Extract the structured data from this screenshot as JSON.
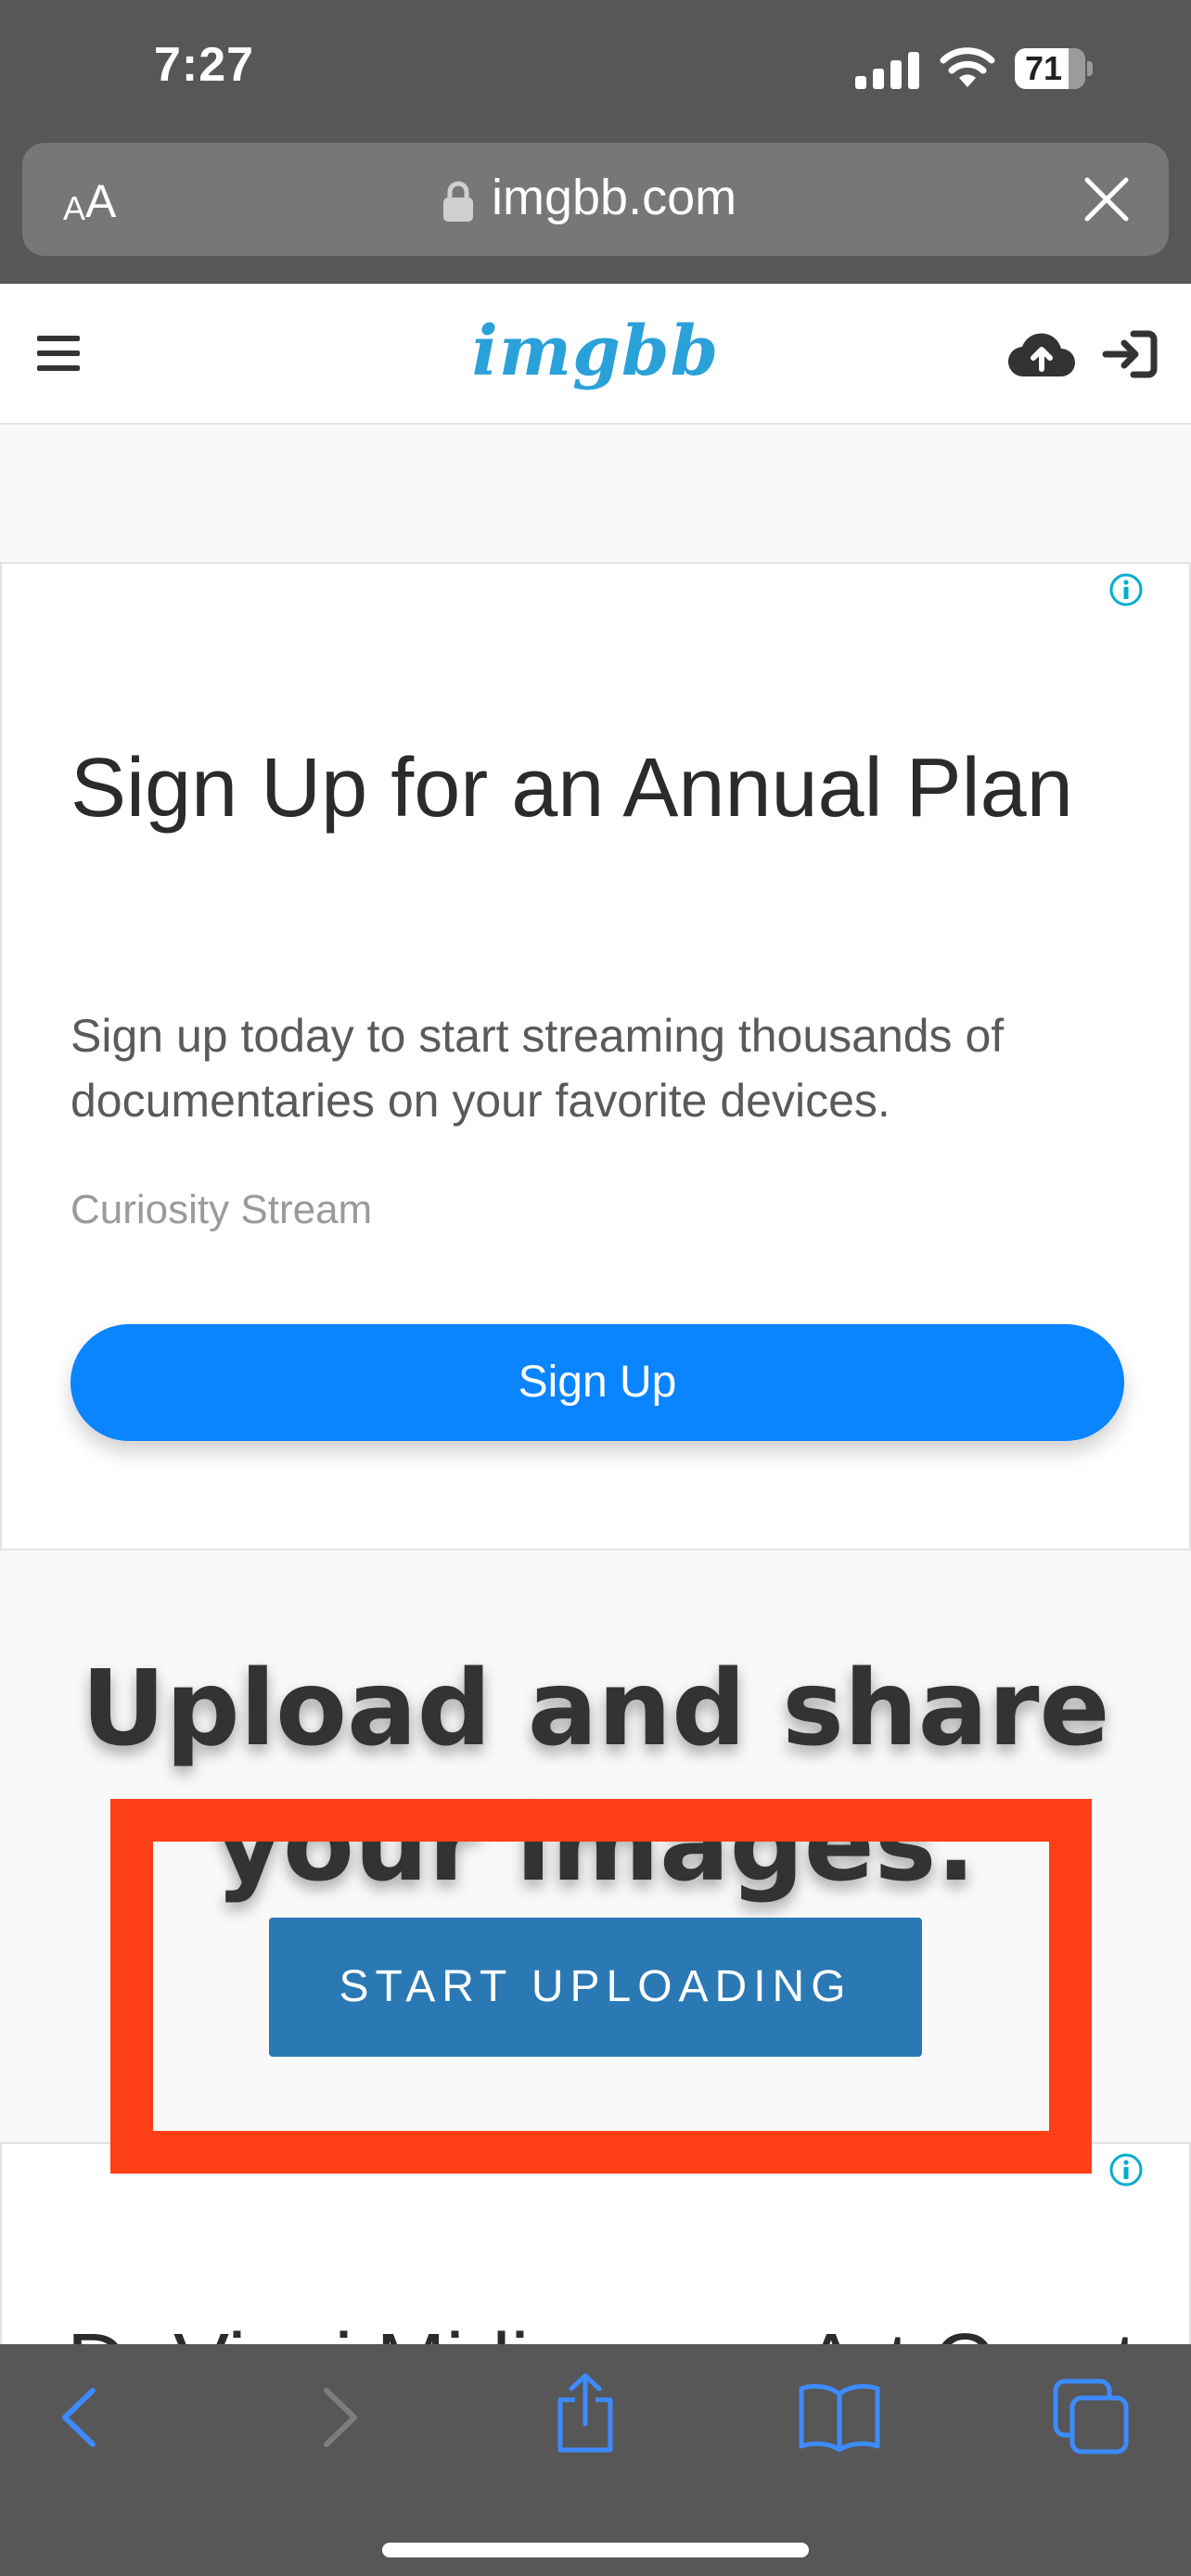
{
  "status_bar": {
    "time": "7:27",
    "battery_level": "71"
  },
  "browser": {
    "aa_small": "A",
    "aa_big": "A",
    "url": "imgbb.com"
  },
  "site": {
    "logo": "imgbb"
  },
  "ad1": {
    "title": "Sign Up for an Annual Plan",
    "description": "Sign up today to start streaming thousands of documentaries on your favorite devices.",
    "advertiser": "Curiosity Stream",
    "cta": "Sign Up"
  },
  "hero": {
    "title": "Upload and share your images.",
    "cta": "START UPLOADING"
  },
  "ad2": {
    "title_partial": "DaVinci Midjourney Art Creator"
  },
  "colors": {
    "chrome": "#575757",
    "brand_blue": "#2ba1d9",
    "ad_button": "#0a84ff",
    "start_button": "#2a79b4",
    "annotation_red": "#ff3f15",
    "ios_blue": "#3d8bff"
  }
}
